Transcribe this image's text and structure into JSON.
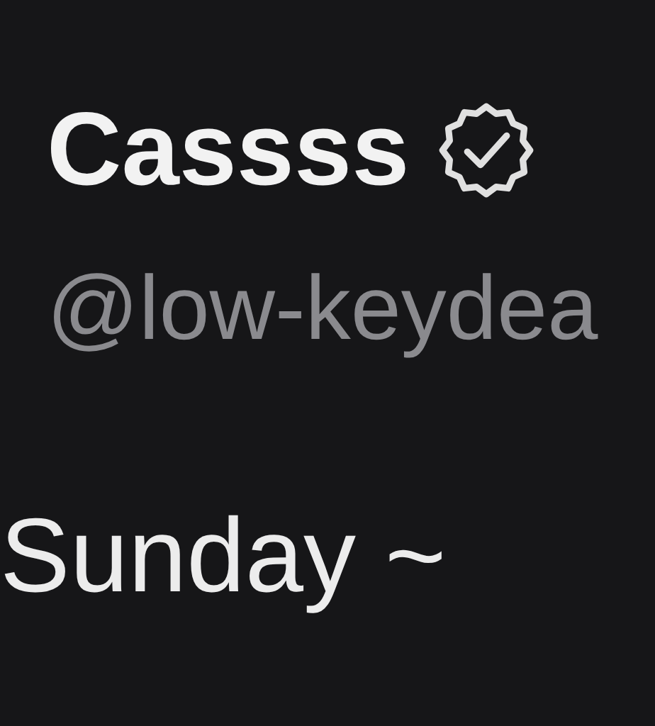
{
  "profile": {
    "name": "Cassss",
    "verified": true,
    "handle": "@low-keydea"
  },
  "status": "Sunday ~"
}
